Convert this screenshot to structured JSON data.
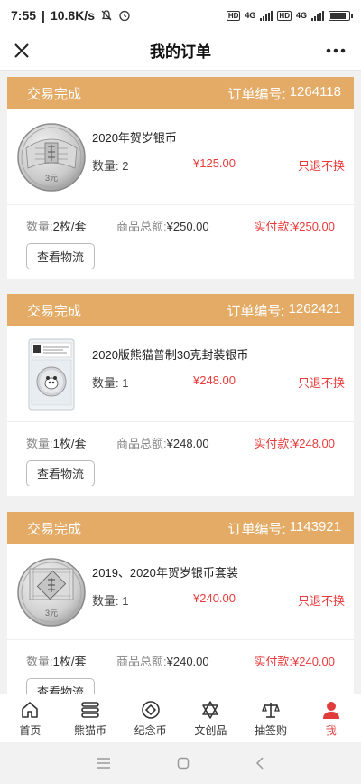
{
  "status_bar": {
    "time": "7:55",
    "speed": "10.8K/s",
    "net1": "4G",
    "net2": "4G",
    "hd": "HD"
  },
  "header": {
    "title": "我的订单"
  },
  "orders": [
    {
      "status": "交易完成",
      "order_no_label": "订单编号:",
      "order_no": "1264118",
      "product_name": "2020年贺岁银币",
      "qty_label": "数量:",
      "qty": "2",
      "price": "¥125.00",
      "policy": "只退不换",
      "unit_label": "数量:",
      "unit": "2枚/套",
      "total_label": "商品总额:",
      "total": "¥250.00",
      "paid_label": "实付款:",
      "paid": "¥250.00",
      "logistics_button": "查看物流",
      "coin_mark": "3元"
    },
    {
      "status": "交易完成",
      "order_no_label": "订单编号:",
      "order_no": "1262421",
      "product_name": "2020版熊猫普制30克封装银币",
      "qty_label": "数量:",
      "qty": "1",
      "price": "¥248.00",
      "policy": "只退不换",
      "unit_label": "数量:",
      "unit": "1枚/套",
      "total_label": "商品总额:",
      "total": "¥248.00",
      "paid_label": "实付款:",
      "paid": "¥248.00",
      "logistics_button": "查看物流"
    },
    {
      "status": "交易完成",
      "order_no_label": "订单编号:",
      "order_no": "1143921",
      "product_name": "2019、2020年贺岁银币套装",
      "qty_label": "数量:",
      "qty": "1",
      "price": "¥240.00",
      "policy": "只退不换",
      "unit_label": "数量:",
      "unit": "1枚/套",
      "total_label": "商品总额:",
      "total": "¥240.00",
      "paid_label": "实付款:",
      "paid": "¥240.00",
      "logistics_button": "查看物流",
      "coin_mark": "3元"
    }
  ],
  "tabbar": {
    "items": [
      {
        "label": "首页",
        "icon": "home-icon"
      },
      {
        "label": "熊猫币",
        "icon": "coin-stack-icon"
      },
      {
        "label": "纪念币",
        "icon": "commemorative-coin-icon"
      },
      {
        "label": "文创品",
        "icon": "star-of-david-icon"
      },
      {
        "label": "抽签购",
        "icon": "scale-icon"
      },
      {
        "label": "我",
        "icon": "user-icon"
      }
    ],
    "active_color": "#e03c3c"
  },
  "colors": {
    "order_header": "#e4ab66",
    "price_red": "#e83b3b"
  }
}
